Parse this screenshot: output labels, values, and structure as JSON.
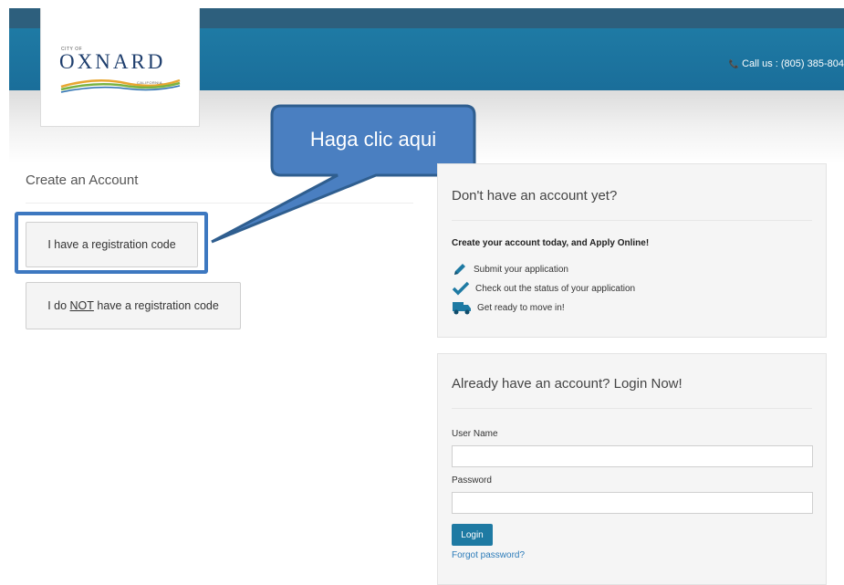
{
  "header": {
    "logo": {
      "city_of": "CITY OF",
      "name": "OXNARD",
      "state": "CALIFORNIA"
    },
    "call_text": "Call us : (805) 385-804"
  },
  "callout": {
    "text": "Haga clic aqui"
  },
  "create_account": {
    "title": "Create an Account",
    "btn_has_code": "I have a registration code",
    "btn_no_code_pre": "I do ",
    "btn_no_code_not": "NOT",
    "btn_no_code_post": " have a registration code"
  },
  "signup_panel": {
    "title": "Don't have an account yet?",
    "lead": "Create your account today, and Apply Online!",
    "features": [
      {
        "icon": "pencil-icon",
        "text": "Submit your application"
      },
      {
        "icon": "checkmark-icon",
        "text": "Check out the status of your application"
      },
      {
        "icon": "truck-icon",
        "text": "Get ready to move in!"
      }
    ]
  },
  "login_panel": {
    "title": "Already have an account? Login Now!",
    "username_label": "User Name",
    "username_value": "",
    "password_label": "Password",
    "password_value": "",
    "login_button": "Login",
    "forgot": "Forgot password?"
  },
  "colors": {
    "header_blue": "#1f7ba5",
    "header_dark": "#2d5f7d",
    "callout_fill": "#4a7fc1",
    "callout_border": "#2f5e8f",
    "highlight": "#3d78c0",
    "login_button": "#1e7aa3",
    "link": "#2b7bb9"
  }
}
